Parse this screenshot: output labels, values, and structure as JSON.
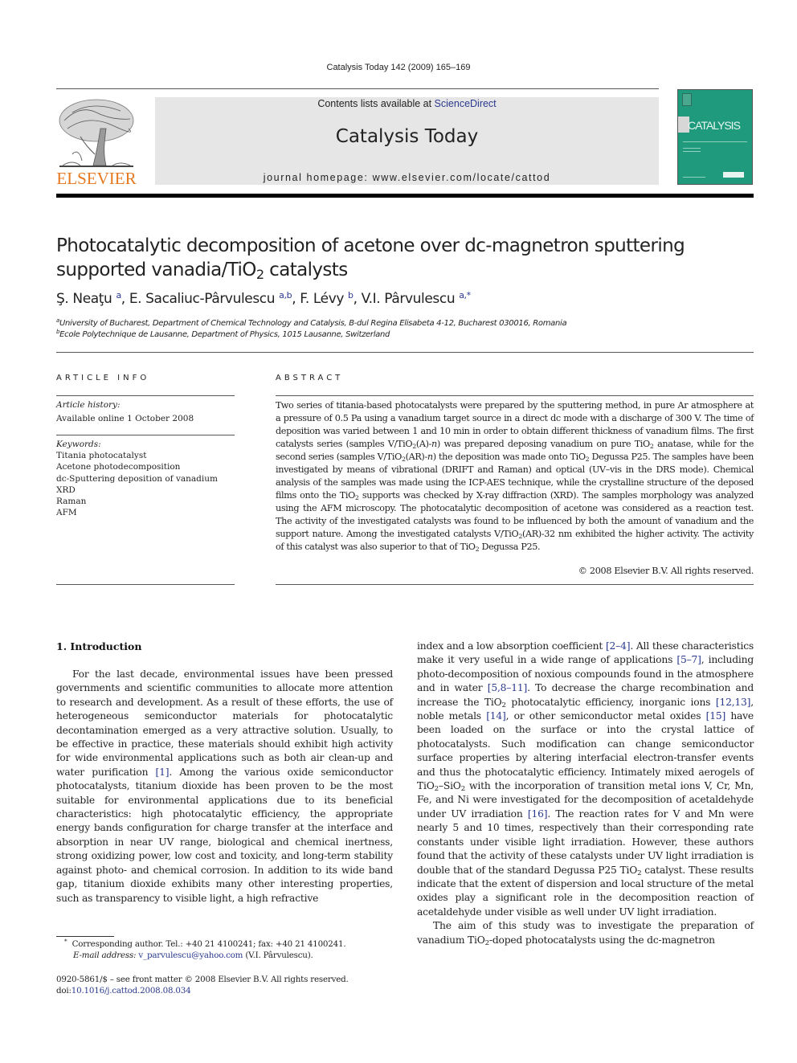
{
  "running_head": "Catalysis Today 142 (2009) 165–169",
  "masthead": {
    "publisher_logo_text": "ELSEVIER",
    "contents_prefix": "Contents lists available at ",
    "contents_link": "ScienceDirect",
    "journal_title": "Catalysis Today",
    "homepage_prefix": "journal homepage: ",
    "homepage_url": "www.elsevier.com/locate/cattod",
    "cover_title": "CATALYSIS",
    "brand_orange": "#e6791f",
    "cover_color": "#1f9a7d",
    "link_color": "#2b3a8f"
  },
  "article": {
    "title_line1": "Photocatalytic decomposition of acetone over dc-magnetron sputtering",
    "title_line2_pre": "supported vanadia/TiO",
    "title_line2_sub": "2",
    "title_line2_post": " catalysts",
    "authors": [
      {
        "name": "Ş. Neaţu",
        "sup": "a"
      },
      {
        "name": "E. Sacaliuc-Pârvulescu",
        "sup": "a,b"
      },
      {
        "name": "F. Lévy",
        "sup": "b"
      },
      {
        "name": "V.I. Pârvulescu",
        "sup": "a,*"
      }
    ],
    "affiliations": [
      {
        "label": "a",
        "text": "University of Bucharest, Department of Chemical Technology and Catalysis, B-dul Regina Elisabeta 4-12, Bucharest 030016, Romania"
      },
      {
        "label": "b",
        "text": "Ecole Polytechnique de Lausanne, Department of Physics, 1015 Lausanne, Switzerland"
      }
    ]
  },
  "article_info": {
    "heading": "ARTICLE INFO",
    "history_label": "Article history:",
    "history_value": "Available online 1 October 2008",
    "keywords_label": "Keywords:",
    "keywords": [
      "Titania photocatalyst",
      "Acetone photodecomposition",
      "dc-Sputtering deposition of vanadium",
      "XRD",
      "Raman",
      "AFM"
    ]
  },
  "abstract": {
    "heading": "ABSTRACT",
    "segments": [
      "Two series of titania-based photocatalysts were prepared by the sputtering method, in pure Ar atmosphere at a pressure of 0.5 Pa using a vanadium target source in a direct dc mode with a discharge of 300 V. The time of deposition was varied between 1 and 10 min in order to obtain different thickness of vanadium films. The first catalysts series (samples V/TiO",
      "2",
      "(A)-",
      "n",
      ") was prepared deposing vanadium on pure TiO",
      "2",
      " anatase, while for the second series (samples V/TiO",
      "2",
      "(AR)-",
      "n",
      ") the deposition was made onto TiO",
      "2",
      " Degussa P25. The samples have been investigated by means of vibrational (DRIFT and Raman) and optical (UV–vis in the DRS mode). Chemical analysis of the samples was made using the ICP-AES technique, while the crystalline structure of the deposed films onto the TiO",
      "2",
      " supports was checked by X-ray diffraction (XRD). The samples morphology was analyzed using the AFM microscopy. The photocatalytic decomposition of acetone was considered as a reaction test. The activity of the investigated catalysts was found to be influenced by both the amount of vanadium and the support nature. Among the investigated catalysts V/TiO",
      "2",
      "(AR)-32 nm exhibited the higher activity. The activity of this catalyst was also superior to that of TiO",
      "2",
      " Degussa P25."
    ],
    "copyright": "© 2008 Elsevier B.V. All rights reserved."
  },
  "introduction": {
    "heading": "1.  Introduction",
    "left_column": {
      "p1": [
        "For the last decade, environmental issues have been pressed governments and scientific communities to allocate more attention to research and development. As a result of these efforts, the use of heterogeneous semiconductor materials for photocatalytic decontamination emerged as a very attractive solution. Usually, to be effective in practice, these materials should exhibit high activity for wide environmental applications such as both air clean-up and water purification ",
        "[1]",
        ". Among the various oxide semiconductor photocatalysts, titanium dioxide has been proven to be the most suitable for environmental applications due to its beneficial characteristics: high photocatalytic efficiency, the appropriate energy bands configuration for charge transfer at the interface and absorption in near UV range, biological and chemical inertness, strong oxidizing power, low cost and toxicity, and long-term stability against photo- and chemical corrosion. In addition to its wide band gap, titanium dioxide exhibits many other interesting properties, such as transparency to visible light, a high refractive"
      ]
    },
    "right_column": {
      "p1": [
        "index and a low absorption coefficient ",
        "[2–4]",
        ". All these characteristics make it very useful in a wide range of applications ",
        "[5–7]",
        ", including photo-decomposition of noxious compounds found in the atmosphere and in water ",
        "[5,8–11]",
        ". To decrease the charge recombination and increase the TiO",
        "2",
        " photocatalytic efficiency, inorganic ions ",
        "[12,13]",
        ", noble metals ",
        "[14]",
        ", or other semiconductor metal oxides ",
        "[15]",
        " have been loaded on the surface or into the crystal lattice of photocatalysts. Such modification can change semiconductor surface properties by altering interfacial electron-transfer events and thus the photocatalytic efficiency. Intimately mixed aerogels of TiO",
        "2",
        "–SiO",
        "2",
        " with the incorporation of transition metal ions V, Cr, Mn, Fe, and Ni were investigated for the decomposition of acetaldehyde under UV irradiation ",
        "[16]",
        ". The reaction rates for V and Mn were nearly 5 and 10 times, respectively than their corresponding rate constants under visible light irradiation. However, these authors found that the activity of these catalysts under UV light irradiation is double that of the standard Degussa P25 TiO",
        "2",
        " catalyst. These results indicate that the extent of dispersion and local structure of the metal oxides play a significant role in the decomposition reaction of acetaldehyde under visible as well under UV light irradiation."
      ],
      "p2": [
        "The aim of this study was to investigate the preparation of vanadium TiO",
        "2",
        "-doped photocatalysts using the dc-magnetron"
      ]
    }
  },
  "footnotes": {
    "corresponding_marker": "*",
    "corresponding_text": "Corresponding author. Tel.: +40 21 4100241; fax: +40 21 4100241.",
    "email_label": "E-mail address:",
    "email": "v_parvulescu@yahoo.com",
    "email_owner": " (V.I. Pârvulescu).",
    "issn_line": "0920-5861/$ – see front matter © 2008 Elsevier B.V. All rights reserved.",
    "doi_prefix": "doi:",
    "doi": "10.1016/j.cattod.2008.08.034"
  }
}
